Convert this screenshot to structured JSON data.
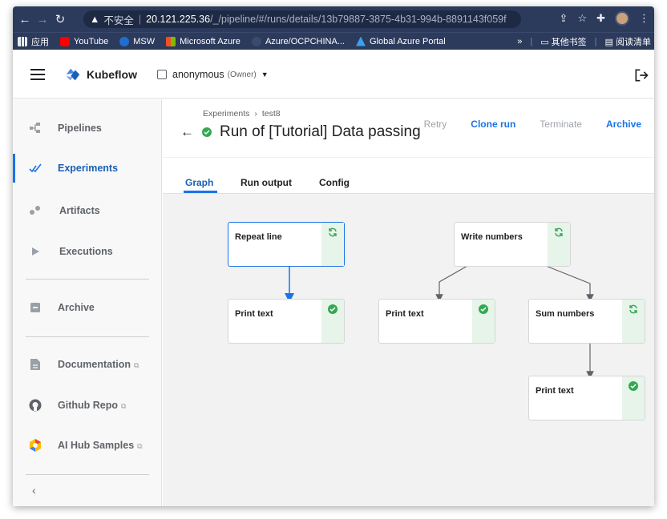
{
  "browser": {
    "security_label": "不安全",
    "url_host": "20.121.225.36",
    "url_path": "/_/pipeline/#/runs/details/13b79887-3875-4b31-994b-8891143f059f",
    "bookmarks": [
      "应用",
      "YouTube",
      "MSW",
      "Microsoft Azure",
      "Azure/OCPCHINA...",
      "Global Azure Portal"
    ],
    "bookmarks_overflow": "»",
    "other_bookmarks": "其他书签",
    "reading_list": "阅读清单"
  },
  "header": {
    "app_name": "Kubeflow",
    "namespace": "anonymous",
    "role": "(Owner)"
  },
  "sidebar": {
    "items": [
      {
        "label": "Pipelines"
      },
      {
        "label": "Experiments"
      },
      {
        "label": "Artifacts"
      },
      {
        "label": "Executions"
      },
      {
        "label": "Archive"
      },
      {
        "label": "Documentation"
      },
      {
        "label": "Github Repo"
      },
      {
        "label": "AI Hub Samples"
      }
    ],
    "collapse": "‹"
  },
  "main": {
    "breadcrumb": [
      "Experiments",
      "test8"
    ],
    "title": "Run of [Tutorial] Data passing in python components",
    "actions": [
      "Retry",
      "Clone run",
      "Terminate",
      "Archive"
    ],
    "tabs": [
      "Graph",
      "Run output",
      "Config"
    ]
  },
  "graph": {
    "nodes": [
      {
        "label": "Repeat line",
        "status": "running"
      },
      {
        "label": "Print text",
        "status": "succeeded"
      },
      {
        "label": "Write numbers",
        "status": "running"
      },
      {
        "label": "Print text",
        "status": "succeeded"
      },
      {
        "label": "Sum numbers",
        "status": "running"
      },
      {
        "label": "Print text",
        "status": "succeeded"
      }
    ]
  },
  "colors": {
    "accent": "#1a73e8",
    "success": "#34a853",
    "browser_chrome": "#2c3a5c"
  }
}
